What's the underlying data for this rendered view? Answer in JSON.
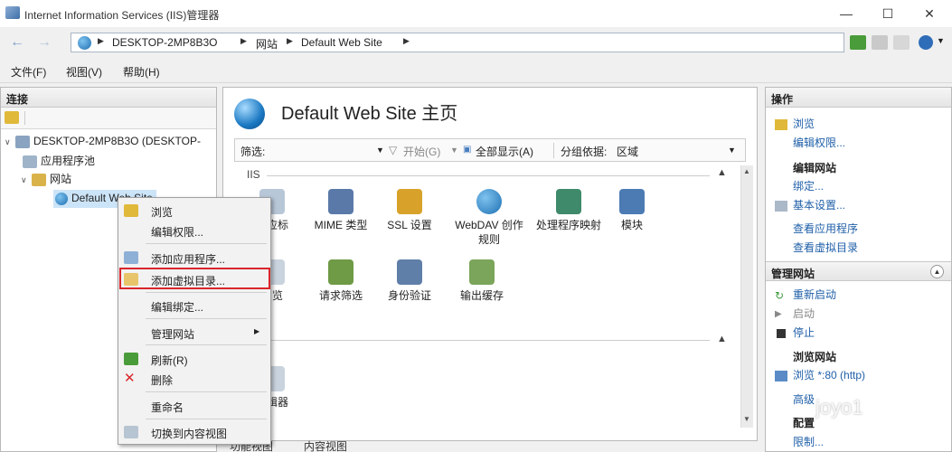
{
  "window": {
    "title": "Internet Information Services (IIS)管理器",
    "controls": [
      "—",
      "☐",
      "✕"
    ]
  },
  "address": {
    "crumbs": [
      "DESKTOP-2MP8B3O",
      "网站",
      "Default Web Site"
    ]
  },
  "menu": [
    "文件(F)",
    "视图(V)",
    "帮助(H)"
  ],
  "connections": {
    "title": "连接",
    "tree": [
      {
        "label": "DESKTOP-2MP8B3O (DESKTOP-",
        "level": 0,
        "toggle": "∨"
      },
      {
        "label": "应用程序池",
        "level": 1,
        "toggle": ""
      },
      {
        "label": "网站",
        "level": 1,
        "toggle": "∨"
      },
      {
        "label": "Default Web Site",
        "level": 2,
        "toggle": ""
      }
    ]
  },
  "main": {
    "title": "Default Web Site 主页",
    "filter": {
      "label": "筛选:",
      "start": "开始(G)",
      "show_all": "全部显示(A)",
      "group_by": "分组依据:",
      "group_value": "区域"
    },
    "group_iis": "IIS",
    "features_row1": [
      "响应标",
      "MIME 类型",
      "SSL 设置",
      "WebDAV 创作规则",
      "处理程序映射",
      "模块"
    ],
    "features_row2": [
      "浏览",
      "请求筛选",
      "身份验证",
      "输出缓存"
    ],
    "feature_row3": "编辑器",
    "tabs": [
      "功能视图",
      "内容视图"
    ]
  },
  "actions": {
    "title": "操作",
    "browse": "浏览",
    "edit_permissions": "编辑权限...",
    "edit_site_head": "编辑网站",
    "bindings": "绑定...",
    "basic_settings": "基本设置...",
    "view_apps": "查看应用程序",
    "view_vdirs": "查看虚拟目录",
    "manage_head": "管理网站",
    "restart": "重新启动",
    "start": "启动",
    "stop": "停止",
    "browse_site_head": "浏览网站",
    "browse_port": "浏览 *:80 (http)",
    "advanced": "高级",
    "config_head": "配置",
    "limits": "限制..."
  },
  "context_menu": {
    "items": [
      "浏览",
      "编辑权限...",
      "添加应用程序...",
      "添加虚拟目录...",
      "编辑绑定...",
      "管理网站",
      "刷新(R)",
      "删除",
      "重命名",
      "切换到内容视图"
    ],
    "highlighted": "添加虚拟目录..."
  },
  "watermark": "joyo1",
  "colors": {
    "link": "#1f5fa8",
    "highlight_border": "#d9262b"
  }
}
